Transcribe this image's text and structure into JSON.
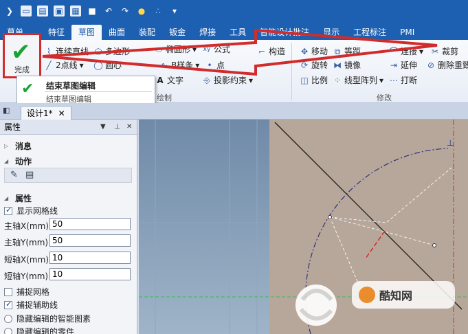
{
  "ribbon_tabs": [
    "草单",
    "特征",
    "草图",
    "曲面",
    "装配",
    "钣金",
    "焊接",
    "工具",
    "智能设计批注",
    "显示",
    "工程标注",
    "PMI"
  ],
  "active_tab": "草图",
  "finish": {
    "label": "完成"
  },
  "tooltip": {
    "title": "结束草图编辑",
    "description": "结束草图编辑"
  },
  "ribbon": {
    "continuous_line": "连续直线",
    "polygon": "多边形",
    "two_point_line": "2点线",
    "circle": "圆心",
    "ellipse": "椭圆形",
    "formula": "公式",
    "spline": "B样条",
    "point": "点",
    "text": "文字",
    "projection": "投影约束",
    "construct": "构造",
    "move": "移动",
    "offset": "等距",
    "rotate": "旋转",
    "mirror": "镜像",
    "scale": "比例",
    "linear_array": "线型阵列",
    "extend": "延伸",
    "break": "打断",
    "trim": "裁剪",
    "remove_overlap": "删除重致",
    "connect": "连接",
    "draw_group": "绘制",
    "modify_group": "修改"
  },
  "document_tab": "设计1*",
  "panel": {
    "title": "属性",
    "messages": "消息",
    "actions": "动作",
    "properties": "属性",
    "show_grid": "显示网格线",
    "major_x_label": "主轴X(mm)",
    "major_x": "50",
    "major_y_label": "主轴Y(mm)",
    "major_y": "50",
    "minor_x_label": "短轴X(mm)",
    "minor_x": "10",
    "minor_y_label": "短轴Y(mm)",
    "minor_y": "10",
    "snap_grid": "捕捉网格",
    "snap_guides": "捕捉辅助线",
    "hide_smart": "隐藏编辑的智能图素",
    "hide_parts": "隐藏编辑的零件"
  },
  "watermark": "酷知网"
}
